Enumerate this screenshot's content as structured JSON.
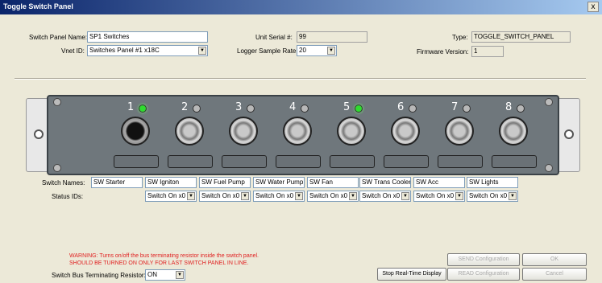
{
  "window": {
    "title": "Toggle Switch Panel",
    "close_label": "x"
  },
  "form": {
    "switch_panel_name_label": "Switch Panel Name:",
    "switch_panel_name_value": "SP1 Switches",
    "vnet_id_label": "Vnet ID:",
    "vnet_id_value": "Switches Panel #1  x18C",
    "unit_serial_label": "Unit Serial #:",
    "unit_serial_value": "99",
    "logger_rate_label": "Logger Sample Rate:",
    "logger_rate_value": "20",
    "type_label": "Type:",
    "type_value": "TOGGLE_SWITCH_PANEL",
    "firmware_label": "Firmware Version:",
    "firmware_value": "1"
  },
  "switches": [
    {
      "number": "1",
      "led": "on",
      "knob": "dark"
    },
    {
      "number": "2",
      "led": "off",
      "knob": "normal"
    },
    {
      "number": "3",
      "led": "off",
      "knob": "normal"
    },
    {
      "number": "4",
      "led": "off",
      "knob": "normal"
    },
    {
      "number": "5",
      "led": "on",
      "knob": "normal"
    },
    {
      "number": "6",
      "led": "off",
      "knob": "normal"
    },
    {
      "number": "7",
      "led": "off",
      "knob": "normal"
    },
    {
      "number": "8",
      "led": "off",
      "knob": "normal"
    }
  ],
  "switch_names_label": "Switch Names:",
  "switch_names": [
    "SW Starter",
    "SW Igniton",
    "SW Fuel Pump",
    "SW Water Pump",
    "SW Fan",
    "SW Trans Cooler",
    "SW Acc",
    "SW Lights"
  ],
  "status_ids_label": "Status IDs:",
  "status_ids": [
    "Switch On x0",
    "Switch On x0",
    "Switch On x0",
    "Switch On x0",
    "Switch On x0",
    "Switch On x0",
    "Switch On x0",
    "Switch On x0"
  ],
  "warning": {
    "line1": "WARNING: Turns on/off the bus terminating resistor inside the switch panel.",
    "line2": "SHOULD BE TURNED ON  ONLY FOR LAST SWITCH PANEL IN LINE."
  },
  "terminating": {
    "label": "Switch Bus Terminating Resistor:",
    "value": "ON"
  },
  "buttons": {
    "stop_realtime": "Stop Real-Time Display",
    "send_config": "SEND Configuration",
    "read_config": "READ Configuration",
    "ok": "OK",
    "cancel": "Cancel"
  },
  "colors": {
    "led_on": "#2fdc2f",
    "warning": "#e02020",
    "title_start": "#0a246a"
  }
}
